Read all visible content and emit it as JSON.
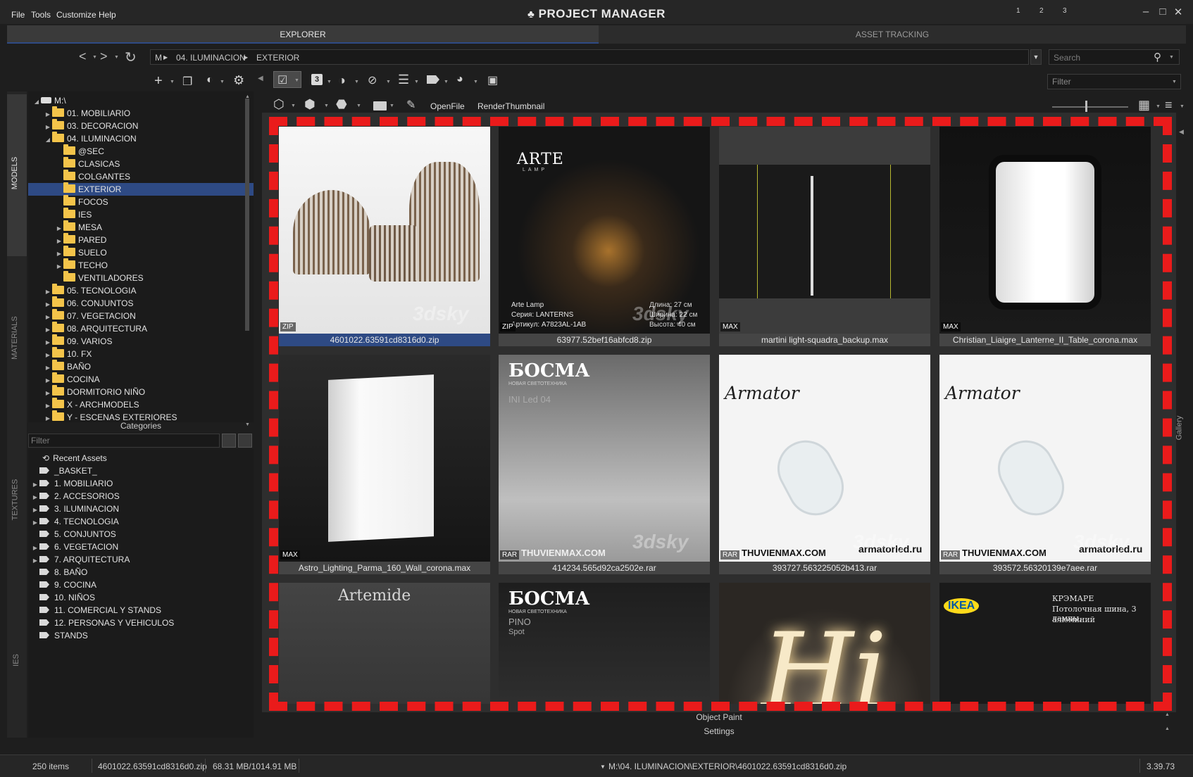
{
  "app": {
    "title": "PROJECT MANAGER"
  },
  "menu": [
    "File",
    "Tools",
    "Customize",
    "Help"
  ],
  "workspaces": [
    "1",
    "2",
    "3"
  ],
  "tabs": {
    "explorer": "EXPLORER",
    "asset_tracking": "ASSET TRACKING"
  },
  "breadcrumb": {
    "root": "M",
    "level1": "04. ILUMINACION",
    "level2": "EXTERIOR"
  },
  "search": {
    "placeholder": "Search"
  },
  "filter": {
    "placeholder": "Filter"
  },
  "toolbar2": {
    "count_badge": "3",
    "open_file": "OpenFile",
    "render_thumbnail": "RenderThumbnail"
  },
  "side_tabs": {
    "models": "MODELS",
    "materials": "MATERIALS",
    "textures": "TEXTURES",
    "ies": "IES"
  },
  "tree": {
    "root": "M:\\",
    "items": [
      {
        "label": "01. MOBILIARIO",
        "depth": 1,
        "expand": "closed"
      },
      {
        "label": "03. DECORACION",
        "depth": 1,
        "expand": "closed"
      },
      {
        "label": "04. ILUMINACION",
        "depth": 1,
        "expand": "open"
      },
      {
        "label": "@SEC",
        "depth": 2,
        "expand": "none"
      },
      {
        "label": "CLASICAS",
        "depth": 2,
        "expand": "none"
      },
      {
        "label": "COLGANTES",
        "depth": 2,
        "expand": "none"
      },
      {
        "label": "EXTERIOR",
        "depth": 2,
        "expand": "none",
        "selected": true
      },
      {
        "label": "FOCOS",
        "depth": 2,
        "expand": "none"
      },
      {
        "label": "IES",
        "depth": 2,
        "expand": "none"
      },
      {
        "label": "MESA",
        "depth": 2,
        "expand": "closed"
      },
      {
        "label": "PARED",
        "depth": 2,
        "expand": "closed"
      },
      {
        "label": "SUELO",
        "depth": 2,
        "expand": "closed"
      },
      {
        "label": "TECHO",
        "depth": 2,
        "expand": "closed"
      },
      {
        "label": "VENTILADORES",
        "depth": 2,
        "expand": "none"
      },
      {
        "label": "05. TECNOLOGIA",
        "depth": 1,
        "expand": "closed"
      },
      {
        "label": "06. CONJUNTOS",
        "depth": 1,
        "expand": "closed"
      },
      {
        "label": "07. VEGETACION",
        "depth": 1,
        "expand": "closed"
      },
      {
        "label": "08. ARQUITECTURA",
        "depth": 1,
        "expand": "closed"
      },
      {
        "label": "09. VARIOS",
        "depth": 1,
        "expand": "closed"
      },
      {
        "label": "10. FX",
        "depth": 1,
        "expand": "closed"
      },
      {
        "label": "BAÑO",
        "depth": 1,
        "expand": "closed"
      },
      {
        "label": "COCINA",
        "depth": 1,
        "expand": "closed"
      },
      {
        "label": "DORMITORIO NIÑO",
        "depth": 1,
        "expand": "closed"
      },
      {
        "label": "X - ARCHMODELS",
        "depth": 1,
        "expand": "closed"
      },
      {
        "label": "Y - ESCENAS EXTERIORES",
        "depth": 1,
        "expand": "closed"
      }
    ]
  },
  "categories": {
    "title": "Categories",
    "filter_placeholder": "Filter",
    "recent": "Recent Assets",
    "items": [
      {
        "label": "_BASKET_",
        "expand": "none"
      },
      {
        "label": "1. MOBILIARIO",
        "expand": "closed"
      },
      {
        "label": "2. ACCESORIOS",
        "expand": "closed"
      },
      {
        "label": "3. ILUMINACION",
        "expand": "closed"
      },
      {
        "label": "4. TECNOLOGIA",
        "expand": "closed"
      },
      {
        "label": "5. CONJUNTOS",
        "expand": "none"
      },
      {
        "label": "6. VEGETACION",
        "expand": "closed"
      },
      {
        "label": "7. ARQUITECTURA",
        "expand": "closed"
      },
      {
        "label": "8. BAÑO",
        "expand": "none"
      },
      {
        "label": "9. COCINA",
        "expand": "none"
      },
      {
        "label": "10. NIÑOS",
        "expand": "none"
      },
      {
        "label": "11. COMERCIAL Y STANDS",
        "expand": "none"
      },
      {
        "label": "12. PERSONAS Y VEHICULOS",
        "expand": "none"
      },
      {
        "label": "STANDS",
        "expand": "none"
      }
    ]
  },
  "gallery": {
    "side_label": "Gallery",
    "items": [
      {
        "name": "4601022.63591cd8316d0.zip",
        "badge": "ZIP",
        "selected": true,
        "watermark": "3dsky"
      },
      {
        "name": "63977.52bef16abfcd8.zip",
        "badge": "ZIP",
        "brand": "ARTE",
        "brand_sub": "LAMP",
        "lines": [
          "Arte Lamp",
          "Серия: LANTERNS",
          "Артикул: A7823AL-1AB"
        ],
        "dims": [
          "Длина: 27 см",
          "Ширина: 22 см",
          "Высота: 40 см"
        ],
        "watermark": "3dsky"
      },
      {
        "name": "martini light-squadra_backup.max",
        "badge": "MAX"
      },
      {
        "name": "Christian_Liaigre_Lanterne_II_Table_corona.max",
        "badge": "MAX"
      },
      {
        "name": "Astro_Lighting_Parma_160_Wall_corona.max",
        "badge": "MAX"
      },
      {
        "name": "414234.565d92ca2502e.rar",
        "badge": "RAR",
        "brand": "БОСМА",
        "brand_sub": "НОВАЯ СВЕТОТЕХНИКА",
        "model": "INI Led 04",
        "site": "THUVIENMAX.COM",
        "watermark": "3dsky"
      },
      {
        "name": "393727.563225052b413.rar",
        "badge": "RAR",
        "brand": "Armator",
        "site": "THUVIENMAX.COM",
        "url": "armatorled.ru",
        "watermark": "3dsky"
      },
      {
        "name": "393572.56320139e7aee.rar",
        "badge": "RAR",
        "brand": "Armator",
        "site": "THUVIENMAX.COM",
        "url": "armatorled.ru",
        "watermark": "3dsky"
      },
      {
        "name": "",
        "brand": "Artemide"
      },
      {
        "name": "",
        "brand": "БОСМА",
        "brand_sub": "НОВАЯ СВЕТОТЕХНИКА",
        "model": "PINO",
        "model_sub": "Spot"
      },
      {
        "name": "",
        "neon": "Hi"
      },
      {
        "name": "",
        "brand": "IKEA",
        "lines": [
          "КРЭМАРЕ",
          "Потолочная шина, 3 лампы,",
          "алюминий"
        ]
      }
    ]
  },
  "bottom": {
    "object_paint": "Object Paint",
    "settings": "Settings"
  },
  "status": {
    "count": "250 items",
    "file": "4601022.63591cd8316d0.zip",
    "size": "68.31 MB/1014.91 MB",
    "path": "M:\\04. ILUMINACION\\EXTERIOR\\4601022.63591cd8316d0.zip",
    "version": "3.39.73"
  },
  "colors": {
    "accent_selection": "#2e4a84",
    "highlight_frame": "#ea1b1b",
    "folder": "#f4c44a"
  }
}
